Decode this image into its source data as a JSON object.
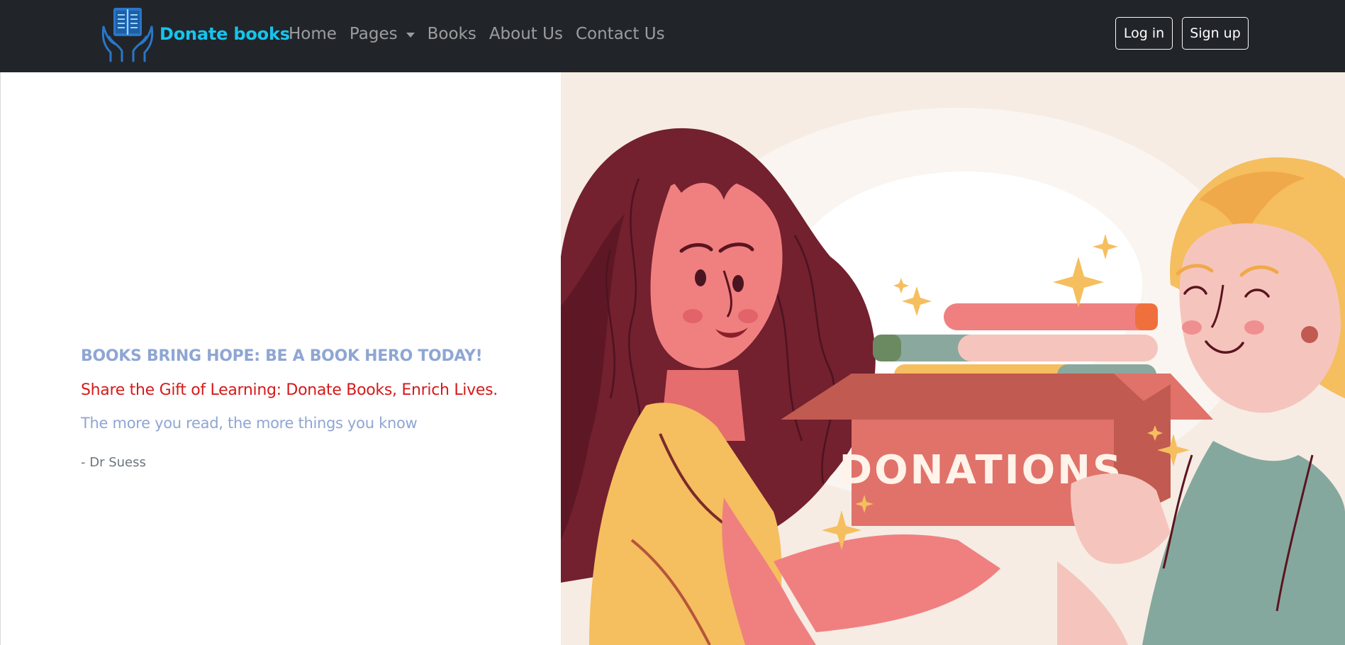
{
  "brand": {
    "name": "Donate books",
    "logo_icon": "book-in-hands-icon"
  },
  "nav": {
    "items": [
      {
        "label": "Home"
      },
      {
        "label": "Pages",
        "has_dropdown": true
      },
      {
        "label": "Books"
      },
      {
        "label": "About Us"
      },
      {
        "label": "Contact Us"
      }
    ]
  },
  "auth": {
    "login_label": "Log in",
    "signup_label": "Sign up"
  },
  "hero": {
    "headline": "BOOKS BRING HOPE: BE A BOOK HERO TODAY!",
    "tagline": "Share the Gift of Learning: Donate Books, Enrich Lives.",
    "quote": "The more you read, the more things you know",
    "quote_author": "- Dr Suess",
    "illustration": {
      "box_label": "DONATIONS"
    }
  },
  "colors": {
    "navbar_bg": "#212529",
    "brand": "#15c4ee",
    "headline": "#8ea6d3",
    "tagline": "#d51a1a",
    "illustration_bg": "#f6ece3"
  }
}
